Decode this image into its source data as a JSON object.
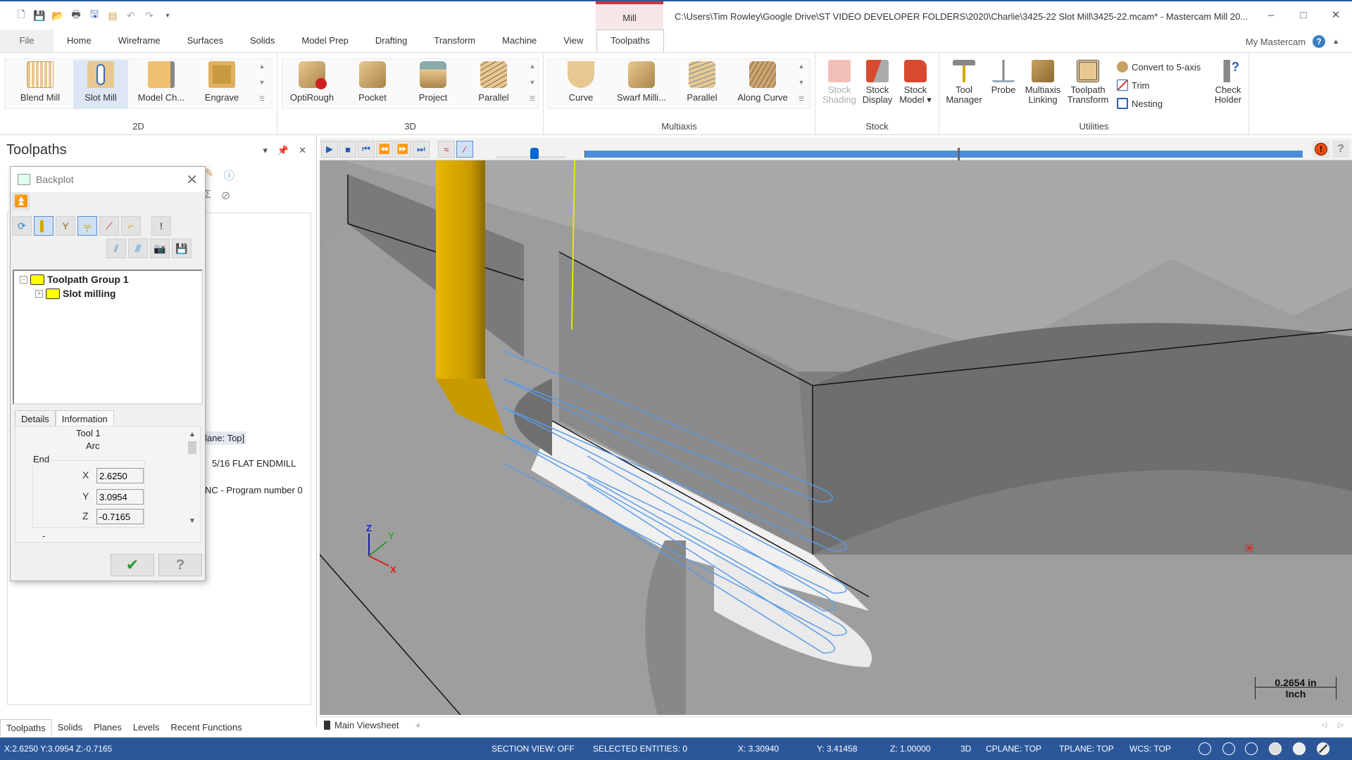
{
  "titlebar": {
    "context_tab": "Mill",
    "window_title": "C:\\Users\\Tim Rowley\\Google Drive\\ST VIDEO DEVELOPER FOLDERS\\2020\\Charlie\\3425-22 Slot Mill\\3425-22.mcam* - Mastercam Mill 20...",
    "quick_access": [
      "new-file-icon",
      "save-icon",
      "open-icon",
      "print-icon",
      "save-as-icon",
      "properties-icon",
      "undo-icon",
      "redo-icon",
      "customize-icon"
    ],
    "controls": {
      "minimize": "–",
      "maximize": "□",
      "close": "✕"
    }
  },
  "ribbon_tabs": [
    "File",
    "Home",
    "Wireframe",
    "Surfaces",
    "Solids",
    "Model Prep",
    "Drafting",
    "Transform",
    "Machine",
    "View",
    "Toolpaths"
  ],
  "active_tab": "Toolpaths",
  "my_mastercam": "My Mastercam",
  "ribbon": {
    "groups": [
      {
        "label": "2D",
        "buttons": [
          "Blend Mill",
          "Slot Mill",
          "Model Ch...",
          "Engrave"
        ]
      },
      {
        "label": "3D",
        "buttons": [
          "OptiRough",
          "Pocket",
          "Project",
          "Parallel"
        ]
      },
      {
        "label": "Multiaxis",
        "buttons": [
          "Curve",
          "Swarf Milli...",
          "Parallel",
          "Along Curve"
        ]
      },
      {
        "label": "Stock",
        "buttons": [
          [
            "Stock",
            "Shading"
          ],
          [
            "Stock",
            "Display"
          ],
          [
            "Stock",
            "Model ▾"
          ]
        ]
      },
      {
        "label": "Utilities",
        "buttons": [
          [
            "Tool",
            "Manager"
          ],
          [
            "Probe",
            ""
          ],
          [
            "Multiaxis",
            "Linking"
          ],
          [
            "Toolpath",
            "Transform"
          ]
        ],
        "small": [
          "Convert to 5-axis",
          "Trim",
          "Nesting"
        ],
        "last": [
          "Check",
          "Holder"
        ]
      }
    ]
  },
  "toolpaths_panel": {
    "title": "Toolpaths",
    "bg_lines": [
      "lane: Top]",
      "5/16 FLAT ENDMILL",
      "NC - Program number 0"
    ],
    "bottom_tabs": [
      "Toolpaths",
      "Solids",
      "Planes",
      "Levels",
      "Recent Functions"
    ]
  },
  "backplot": {
    "title": "Backplot",
    "tree": [
      {
        "label": "Toolpath Group 1",
        "expanded": true
      },
      {
        "label": "Slot milling",
        "expanded": false
      }
    ],
    "tabs": [
      "Details",
      "Information"
    ],
    "details": {
      "tool": "Tool 1",
      "move_type": "Arc",
      "section": "End",
      "x_label": "X",
      "x": "2.6250",
      "y_label": "Y",
      "y": "3.0954",
      "z_label": "Z",
      "z": "-0.7165",
      "more": "-"
    },
    "ok_icon": "✔",
    "help_icon": "?"
  },
  "playback": {
    "buttons": [
      "play",
      "stop",
      "go-to-start",
      "step-back",
      "step-forward",
      "go-to-end",
      "show-toolpath",
      "show-tool"
    ],
    "speed_fraction": 0.55,
    "progress_fraction": 0.52
  },
  "viewport": {
    "scale_value": "0.2654 in",
    "scale_unit": "Inch",
    "axis": {
      "x": "X",
      "y": "Y",
      "z": "Z"
    }
  },
  "viewsheet": {
    "tab": "Main Viewsheet",
    "add": "+"
  },
  "statusbar": {
    "coords": "X:2.6250   Y:3.0954   Z:-0.7165",
    "section_view": "SECTION VIEW: OFF",
    "selected": "SELECTED ENTITIES: 0",
    "x": "X:   3.30940",
    "y": "Y:   3.41458",
    "z": "Z:   1.00000",
    "mode": "3D",
    "cplane": "CPLANE: TOP",
    "tplane": "TPLANE: TOP",
    "wcs": "WCS: TOP"
  },
  "colors": {
    "accent": "#2b579a",
    "tool": "#d4a800",
    "toolpath": "#5a9be8",
    "context": "#d13438"
  }
}
